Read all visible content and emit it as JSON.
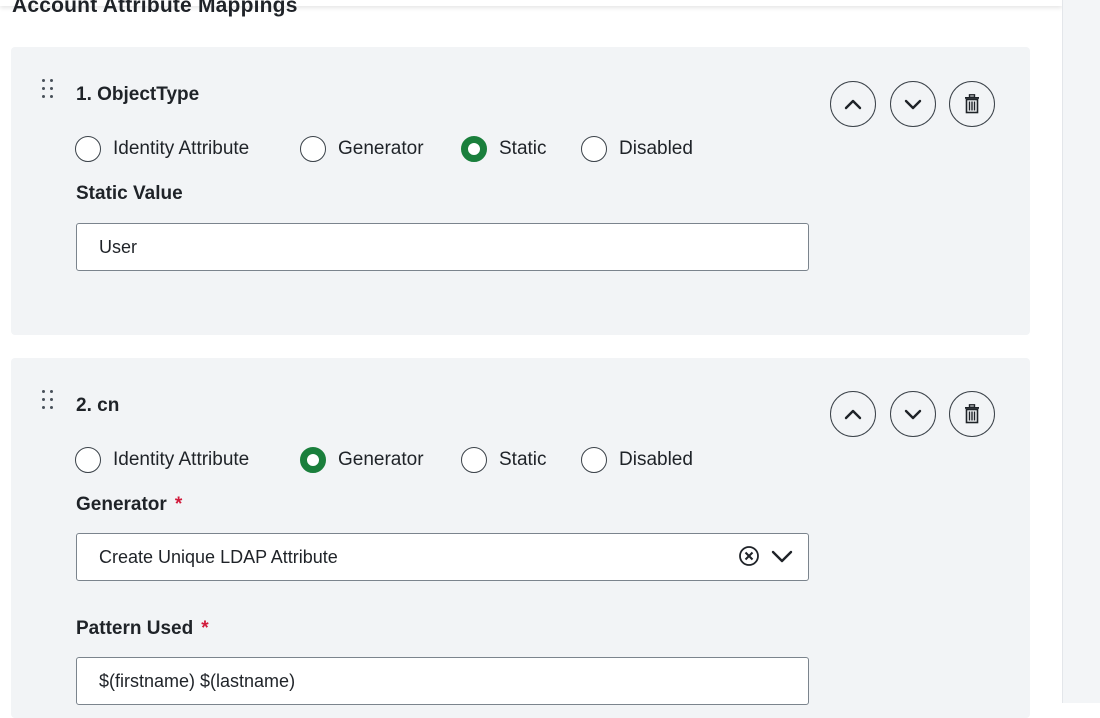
{
  "section": {
    "title": "Account Attribute Mappings"
  },
  "mappings": [
    {
      "title": "1. ObjectType",
      "options": [
        "Identity Attribute",
        "Generator",
        "Static",
        "Disabled"
      ],
      "selected": "Static",
      "field_label": "Static Value",
      "field_value": "User"
    },
    {
      "title": "2. cn",
      "options": [
        "Identity Attribute",
        "Generator",
        "Static",
        "Disabled"
      ],
      "selected": "Generator",
      "generator_label": "Generator",
      "generator_value": "Create Unique LDAP Attribute",
      "pattern_label": "Pattern Used",
      "pattern_value": "$(firstname) $(lastname)",
      "required_mark": "*"
    }
  ],
  "icons": {
    "drag": "drag-handle-icon",
    "move_up": "chevron-up-icon",
    "move_down": "chevron-down-icon",
    "delete": "trash-icon",
    "clear": "clear-circle-icon",
    "dropdown": "chevron-down-icon"
  },
  "colors": {
    "selected_radio": "#1a7f3c",
    "required": "#d11a3b",
    "card_bg": "#f2f4f6"
  }
}
